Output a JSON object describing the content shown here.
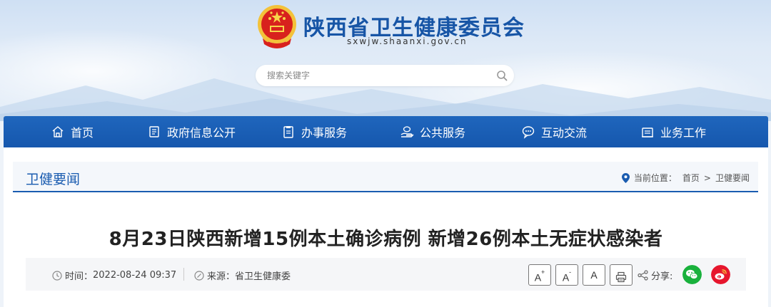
{
  "header": {
    "site_title": "陕西省卫生健康委员会",
    "site_domain": "sxwjw.shaanxi.gov.cn",
    "search_placeholder": "搜索关键字"
  },
  "nav": {
    "items": [
      {
        "label": "首页",
        "icon": "home-icon"
      },
      {
        "label": "政府信息公开",
        "icon": "document-list-icon"
      },
      {
        "label": "办事服务",
        "icon": "clipboard-icon"
      },
      {
        "label": "公共服务",
        "icon": "hand-service-icon"
      },
      {
        "label": "互动交流",
        "icon": "chat-icon"
      },
      {
        "label": "业务工作",
        "icon": "briefcase-icon"
      }
    ]
  },
  "breadcrumb": {
    "section_title": "卫健要闻",
    "location_label": "当前位置：",
    "items": [
      "首页",
      "卫健要闻"
    ],
    "separator": ">"
  },
  "article": {
    "title": "8月23日陕西新增15例本土确诊病例 新增26例本土无症状感染者",
    "time_label": "时间：",
    "time_value": "2022-08-24 09:37",
    "source_label": "来源：",
    "source_value": "省卫生健康委"
  },
  "toolbar": {
    "font_large": "A",
    "font_large_sup": "+",
    "font_small": "A",
    "font_small_sup": "-",
    "font_default": "A",
    "share_label": "分享:"
  },
  "colors": {
    "brand_blue": "#1a5cb0",
    "wechat_green": "#19b13c",
    "weibo_red": "#e6162d"
  }
}
